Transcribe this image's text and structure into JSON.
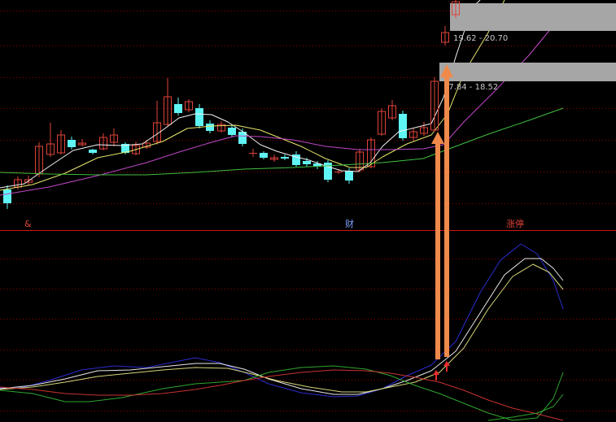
{
  "colors": {
    "background": "#000000",
    "grid": "#8b0000",
    "up_candle": "#e0433a",
    "down_candle": "#5ff5f5",
    "ma_fast": "#f2f2f2",
    "ma_mid": "#e6e66a",
    "ma_slow": "#c048c8",
    "ma_long": "#3fbf3f",
    "zone_fill": "#a6a6a6",
    "arrow": "#f08a4b",
    "small_arrow": "#e82c2c",
    "ind_blue": "#2c2ccf",
    "ind_white": "#e8e8e8",
    "ind_yellow": "#d6d67a",
    "ind_green": "#2fa52f",
    "ind_red": "#c83232",
    "ind_gray": "#6a6a6a"
  },
  "markers": {
    "left": "&",
    "middle": "财",
    "right": "涨停"
  },
  "zones": [
    {
      "label": "19.62 - 20.70"
    },
    {
      "label": "17.84 - 18.52"
    }
  ],
  "signals": {
    "arrow_icon": "up-arrow",
    "small_marker_icon": "small-up-arrow"
  }
}
